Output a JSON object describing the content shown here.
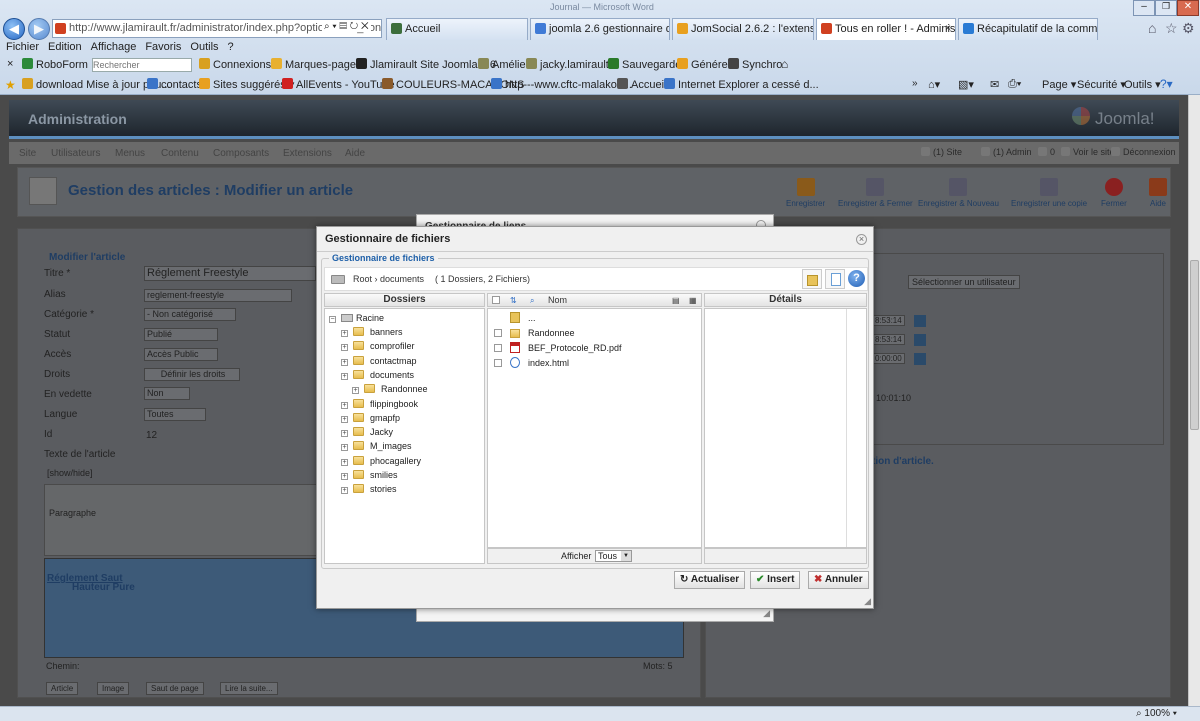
{
  "browser": {
    "window_title": "Journal — Microsoft Word",
    "url": "http://www.jlamirault.fr/administrator/index.php?option=com_con",
    "tabs": [
      {
        "label": "Accueil",
        "color": "#3c6e3c"
      },
      {
        "label": "joomla 2.6 gestionnaire de fich...",
        "color": "#3f7ad6"
      },
      {
        "label": "JomSocial 2.6.2 : l'extension Jo...",
        "color": "#e8a020"
      },
      {
        "label": "Tous en roller ! - Administra...",
        "color": "#d04020"
      },
      {
        "label": "Récapitulatif de la commande ...",
        "color": "#2a7bd4"
      }
    ],
    "menu": [
      "Fichier",
      "Edition",
      "Affichage",
      "Favoris",
      "Outils",
      "?"
    ],
    "toolbar1": {
      "close": "×",
      "roboform": "RoboForm",
      "search_placeholder": "Rechercher",
      "items": [
        "Connexions",
        "Marques-page",
        "Jlamirault Site Joomla 2.6",
        "Amélie",
        "jacky.lamirault",
        "Sauvegarder",
        "Générer",
        "Synchro"
      ]
    },
    "toolbar2": {
      "favorites": [
        "download Mise à jour pou...",
        "contacts",
        "Sites suggérés",
        "AllEvents - YouTube",
        "COULEURS-MACARONS",
        "http---www.cftc-malakoff...",
        "Accueil",
        "Internet Explorer a cessé d..."
      ],
      "right": [
        "Page",
        "Sécurité",
        "Outils"
      ]
    },
    "zoom": "100%"
  },
  "joomla": {
    "header_title": "Administration",
    "logo": "Joomla!",
    "menu": [
      "Site",
      "Utilisateurs",
      "Menus",
      "Contenu",
      "Composants",
      "Extensions",
      "Aide"
    ],
    "status": [
      "(1) Site",
      "(1) Admin",
      "0",
      "Voir le site",
      "Déconnexion"
    ],
    "page_title": "Gestion des articles : Modifier un article",
    "toolbar": [
      "Enregistrer",
      "Enregistrer & Fermer",
      "Enregistrer & Nouveau",
      "Enregistrer une copie",
      "Fermer",
      "Aide"
    ],
    "form": {
      "legend": "Modifier l'article",
      "labels": [
        "Titre *",
        "Alias",
        "Catégorie *",
        "Statut",
        "Accès",
        "Droits",
        "En vedette",
        "Langue",
        "Id",
        "Texte de l'article"
      ],
      "title_value": "Réglement Freestyle",
      "alias_value": "reglement-freestyle",
      "category_value": "- Non catégorisé",
      "status_value": "Publié",
      "access_value": "Accès Public",
      "rights_button": "Définir les droits",
      "featured_value": "Non",
      "language_value": "Toutes",
      "id_value": "12",
      "showhide": "[show/hide]",
      "paragraph": "Paragraphe",
      "editor_text1": "Réglement Saut",
      "editor_text2": "Hauteur Pure",
      "path_label": "Chemin:",
      "words": "Mots: 5",
      "bottom_buttons": [
        "Article",
        "Image",
        "Saut de page",
        "Lire la suite..."
      ]
    },
    "right": {
      "select_user": "Sélectionner un utilisateur",
      "times": [
        "8:53:14",
        "8:53:14",
        "0:00:00"
      ],
      "time2": "10:01:10",
      "option": "tion d'article."
    }
  },
  "link_manager": {
    "title": "Gestionnaire de liens"
  },
  "file_manager": {
    "title": "Gestionnaire de fichiers",
    "legend": "Gestionnaire de fichiers",
    "path": "Root › documents",
    "counts": "( 1 Dossiers, 2 Fichiers)",
    "col_folders": "Dossiers",
    "col_name": "Nom",
    "col_details": "Détails",
    "tree_root": "Racine",
    "tree": [
      "banners",
      "comprofiler",
      "contactmap",
      "documents",
      "flippingbook",
      "gmapfp",
      "Jacky",
      "M_images",
      "phocagallery",
      "smilies",
      "stories"
    ],
    "tree_child": "Randonnee",
    "files": [
      {
        "name": "...",
        "kind": "up"
      },
      {
        "name": "Randonnee",
        "kind": "folder"
      },
      {
        "name": "BEF_Protocole_RD.pdf",
        "kind": "pdf"
      },
      {
        "name": "index.html",
        "kind": "html"
      }
    ],
    "show_label": "Afficher",
    "show_value": "Tous",
    "buttons": {
      "refresh": "Actualiser",
      "insert": "Insert",
      "cancel": "Annuler"
    }
  }
}
